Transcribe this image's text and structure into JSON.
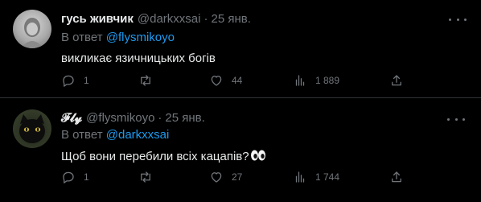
{
  "tweets": [
    {
      "display_name": "гусь живчик",
      "handle": "@darkxxsai",
      "date": "25 янв.",
      "reply_prefix": "В ответ",
      "reply_to": "@flysmikoyo",
      "text": "викликає язичницьких богів",
      "replies": "1",
      "retweets": "",
      "likes": "44",
      "views": "1 889",
      "avatar_icon": "user-avatar-light"
    },
    {
      "display_name": "𝓕𝓵𝔂",
      "handle": "@flysmikoyo",
      "date": "25 янв.",
      "reply_prefix": "В ответ",
      "reply_to": "@darkxxsai",
      "text": "Щоб вони перебили всіх кацапів?",
      "text_emoji": "👀",
      "replies": "1",
      "retweets": "",
      "likes": "27",
      "views": "1 744",
      "avatar_icon": "black-cat-avatar"
    }
  ],
  "colors": {
    "background": "#000000",
    "text_primary": "#e7e9ea",
    "text_secondary": "#71767b",
    "accent": "#1d9bf0",
    "divider": "#2f3336"
  }
}
